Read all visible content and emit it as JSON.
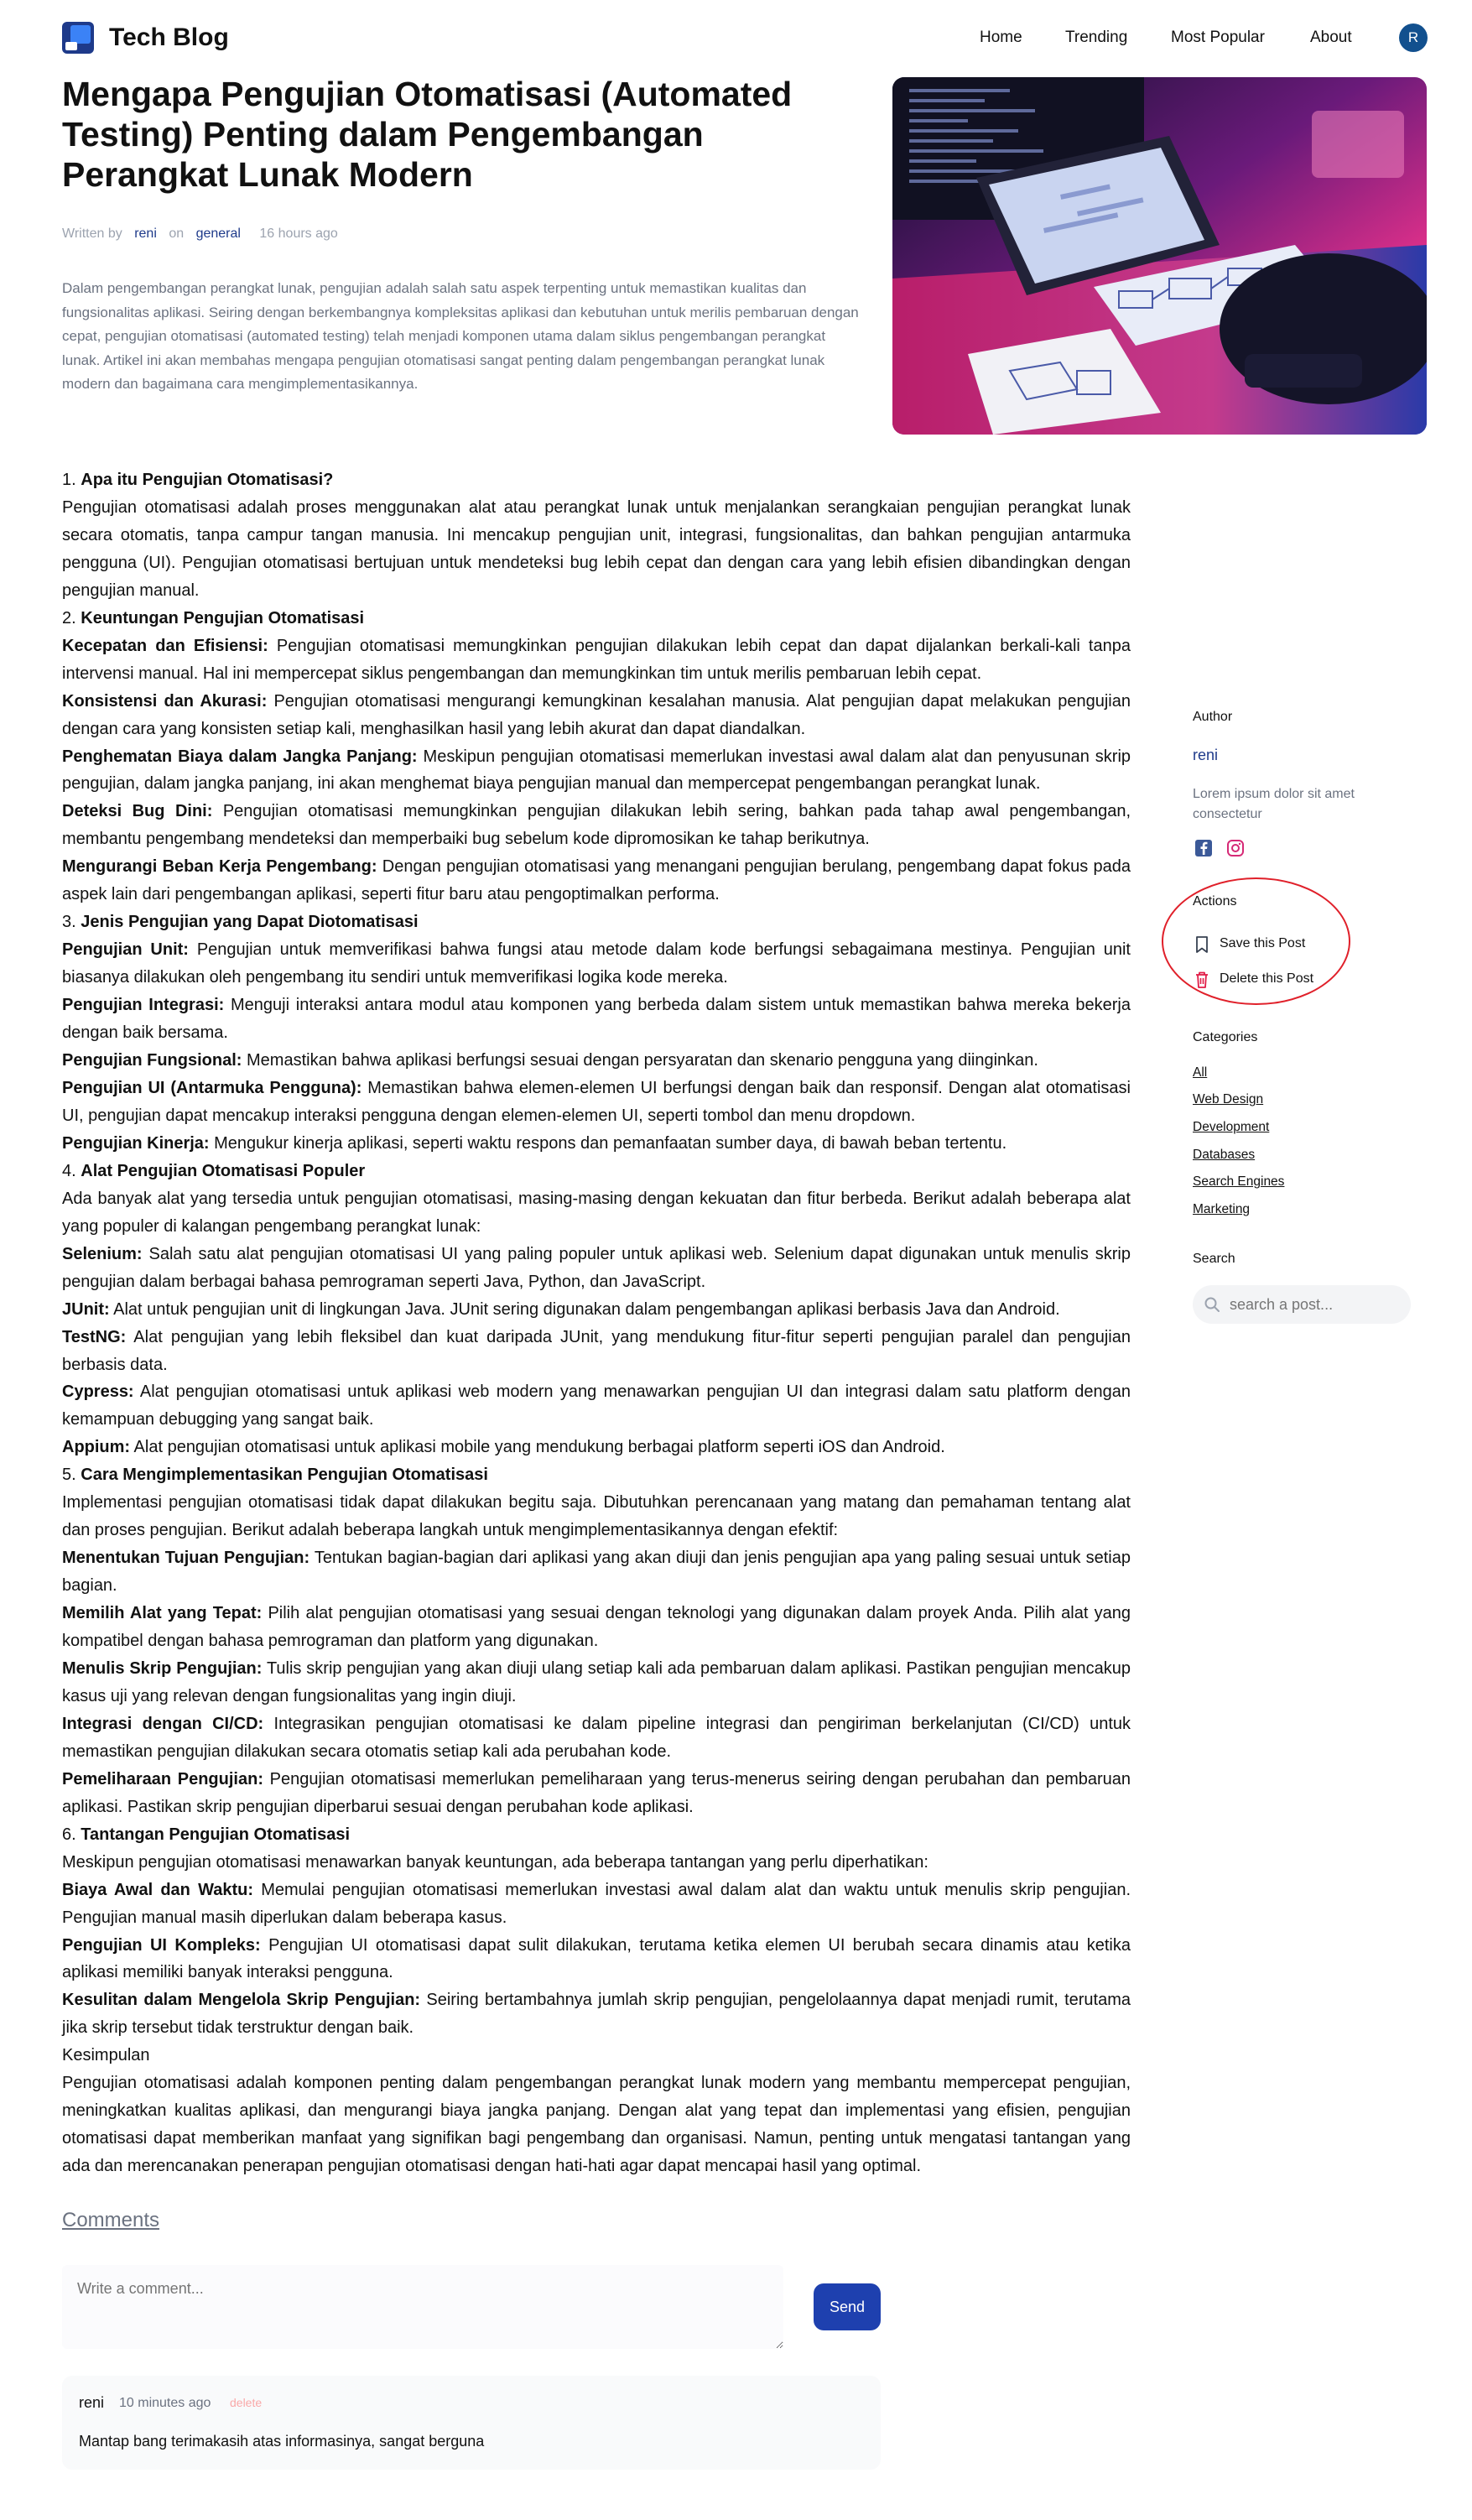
{
  "header": {
    "brand": "Tech Blog",
    "nav": [
      "Home",
      "Trending",
      "Most Popular",
      "About"
    ],
    "avatar_initial": "R"
  },
  "post": {
    "title": "Mengapa Pengujian Otomatisasi (Automated Testing) Penting dalam Pengembangan Perangkat Lunak Modern",
    "meta": {
      "written_by_label": "Written by",
      "author": "reni",
      "on_label": "on",
      "category": "general",
      "time": "16 hours ago"
    },
    "excerpt": "Dalam pengembangan perangkat lunak, pengujian adalah salah satu aspek terpenting untuk memastikan kualitas dan fungsionalitas aplikasi. Seiring dengan berkembangnya kompleksitas aplikasi dan kebutuhan untuk merilis pembaruan dengan cepat, pengujian otomatisasi (automated testing) telah menjadi komponen utama dalam siklus pengembangan perangkat lunak. Artikel ini akan membahas mengapa pengujian otomatisasi sangat penting dalam pengembangan perangkat lunak modern dan bagaimana cara mengimplementasikannya.",
    "hero_image": "laptop-coding-illustration"
  },
  "article": [
    {
      "type": "heading",
      "num": "1. ",
      "text": "Apa itu Pengujian Otomatisasi?"
    },
    {
      "type": "para",
      "text": "Pengujian otomatisasi adalah proses menggunakan alat atau perangkat lunak untuk menjalankan serangkaian pengujian perangkat lunak secara otomatis, tanpa campur tangan manusia. Ini mencakup pengujian unit, integrasi, fungsionalitas, dan bahkan pengujian antarmuka pengguna (UI). Pengujian otomatisasi bertujuan untuk mendeteksi bug lebih cepat dan dengan cara yang lebih efisien dibandingkan dengan pengujian manual."
    },
    {
      "type": "heading",
      "num": "2. ",
      "text": "Keuntungan Pengujian Otomatisasi"
    },
    {
      "type": "term",
      "term": "Kecepatan dan Efisiensi:",
      "text": " Pengujian otomatisasi memungkinkan pengujian dilakukan lebih cepat dan dapat dijalankan berkali-kali tanpa intervensi manual. Hal ini mempercepat siklus pengembangan dan memungkinkan tim untuk merilis pembaruan lebih cepat."
    },
    {
      "type": "term",
      "term": "Konsistensi dan Akurasi:",
      "text": " Pengujian otomatisasi mengurangi kemungkinan kesalahan manusia. Alat pengujian dapat melakukan pengujian dengan cara yang konsisten setiap kali, menghasilkan hasil yang lebih akurat dan dapat diandalkan."
    },
    {
      "type": "term",
      "term": "Penghematan Biaya dalam Jangka Panjang:",
      "text": " Meskipun pengujian otomatisasi memerlukan investasi awal dalam alat dan penyusunan skrip pengujian, dalam jangka panjang, ini akan menghemat biaya pengujian manual dan mempercepat pengembangan perangkat lunak."
    },
    {
      "type": "term",
      "term": "Deteksi Bug Dini:",
      "text": " Pengujian otomatisasi memungkinkan pengujian dilakukan lebih sering, bahkan pada tahap awal pengembangan, membantu pengembang mendeteksi dan memperbaiki bug sebelum kode dipromosikan ke tahap berikutnya."
    },
    {
      "type": "term",
      "term": "Mengurangi Beban Kerja Pengembang:",
      "text": " Dengan pengujian otomatisasi yang menangani pengujian berulang, pengembang dapat fokus pada aspek lain dari pengembangan aplikasi, seperti fitur baru atau pengoptimalkan performa."
    },
    {
      "type": "heading",
      "num": "3. ",
      "text": "Jenis Pengujian yang Dapat Diotomatisasi"
    },
    {
      "type": "term",
      "term": "Pengujian Unit:",
      "text": " Pengujian untuk memverifikasi bahwa fungsi atau metode dalam kode berfungsi sebagaimana mestinya. Pengujian unit biasanya dilakukan oleh pengembang itu sendiri untuk memverifikasi logika kode mereka."
    },
    {
      "type": "term",
      "term": "Pengujian Integrasi:",
      "text": " Menguji interaksi antara modul atau komponen yang berbeda dalam sistem untuk memastikan bahwa mereka bekerja dengan baik bersama."
    },
    {
      "type": "term",
      "term": "Pengujian Fungsional:",
      "text": " Memastikan bahwa aplikasi berfungsi sesuai dengan persyaratan dan skenario pengguna yang diinginkan."
    },
    {
      "type": "term",
      "term": "Pengujian UI (Antarmuka Pengguna):",
      "text": " Memastikan bahwa elemen-elemen UI berfungsi dengan baik dan responsif. Dengan alat otomatisasi UI, pengujian dapat mencakup interaksi pengguna dengan elemen-elemen UI, seperti tombol dan menu dropdown."
    },
    {
      "type": "term",
      "term": "Pengujian Kinerja:",
      "text": " Mengukur kinerja aplikasi, seperti waktu respons dan pemanfaatan sumber daya, di bawah beban tertentu."
    },
    {
      "type": "heading",
      "num": "4. ",
      "text": "Alat Pengujian Otomatisasi Populer"
    },
    {
      "type": "para",
      "text": "Ada banyak alat yang tersedia untuk pengujian otomatisasi, masing-masing dengan kekuatan dan fitur berbeda. Berikut adalah beberapa alat yang populer di kalangan pengembang perangkat lunak:"
    },
    {
      "type": "term",
      "term": "Selenium:",
      "text": " Salah satu alat pengujian otomatisasi UI yang paling populer untuk aplikasi web. Selenium dapat digunakan untuk menulis skrip pengujian dalam berbagai bahasa pemrograman seperti Java, Python, dan JavaScript."
    },
    {
      "type": "term",
      "term": "JUnit:",
      "text": " Alat untuk pengujian unit di lingkungan Java. JUnit sering digunakan dalam pengembangan aplikasi berbasis Java dan Android."
    },
    {
      "type": "term",
      "term": "TestNG:",
      "text": " Alat pengujian yang lebih fleksibel dan kuat daripada JUnit, yang mendukung fitur-fitur seperti pengujian paralel dan pengujian berbasis data."
    },
    {
      "type": "term",
      "term": "Cypress:",
      "text": " Alat pengujian otomatisasi untuk aplikasi web modern yang menawarkan pengujian UI dan integrasi dalam satu platform dengan kemampuan debugging yang sangat baik."
    },
    {
      "type": "term",
      "term": "Appium:",
      "text": " Alat pengujian otomatisasi untuk aplikasi mobile yang mendukung berbagai platform seperti iOS dan Android."
    },
    {
      "type": "heading",
      "num": "5. ",
      "text": "Cara Mengimplementasikan Pengujian Otomatisasi"
    },
    {
      "type": "para",
      "text": "Implementasi pengujian otomatisasi tidak dapat dilakukan begitu saja. Dibutuhkan perencanaan yang matang dan pemahaman tentang alat dan proses pengujian. Berikut adalah beberapa langkah untuk mengimplementasikannya dengan efektif:"
    },
    {
      "type": "term",
      "term": "Menentukan Tujuan Pengujian:",
      "text": " Tentukan bagian-bagian dari aplikasi yang akan diuji dan jenis pengujian apa yang paling sesuai untuk setiap bagian."
    },
    {
      "type": "term",
      "term": "Memilih Alat yang Tepat:",
      "text": " Pilih alat pengujian otomatisasi yang sesuai dengan teknologi yang digunakan dalam proyek Anda. Pilih alat yang kompatibel dengan bahasa pemrograman dan platform yang digunakan."
    },
    {
      "type": "term",
      "term": "Menulis Skrip Pengujian:",
      "text": " Tulis skrip pengujian yang akan diuji ulang setiap kali ada pembaruan dalam aplikasi. Pastikan pengujian mencakup kasus uji yang relevan dengan fungsionalitas yang ingin diuji."
    },
    {
      "type": "term",
      "term": "Integrasi dengan CI/CD:",
      "text": " Integrasikan pengujian otomatisasi ke dalam pipeline integrasi dan pengiriman berkelanjutan (CI/CD) untuk memastikan pengujian dilakukan secara otomatis setiap kali ada perubahan kode."
    },
    {
      "type": "term",
      "term": "Pemeliharaan Pengujian:",
      "text": " Pengujian otomatisasi memerlukan pemeliharaan yang terus-menerus seiring dengan perubahan dan pembaruan aplikasi. Pastikan skrip pengujian diperbarui sesuai dengan perubahan kode aplikasi."
    },
    {
      "type": "heading",
      "num": "6. ",
      "text": "Tantangan Pengujian Otomatisasi"
    },
    {
      "type": "para",
      "text": "Meskipun pengujian otomatisasi menawarkan banyak keuntungan, ada beberapa tantangan yang perlu diperhatikan:"
    },
    {
      "type": "term",
      "term": "Biaya Awal dan Waktu:",
      "text": " Memulai pengujian otomatisasi memerlukan investasi awal dalam alat dan waktu untuk menulis skrip pengujian. Pengujian manual masih diperlukan dalam beberapa kasus."
    },
    {
      "type": "term",
      "term": "Pengujian UI Kompleks:",
      "text": " Pengujian UI otomatisasi dapat sulit dilakukan, terutama ketika elemen UI berubah secara dinamis atau ketika aplikasi memiliki banyak interaksi pengguna."
    },
    {
      "type": "term",
      "term": "Kesulitan dalam Mengelola Skrip Pengujian:",
      "text": " Seiring bertambahnya jumlah skrip pengujian, pengelolaannya dapat menjadi rumit, terutama jika skrip tersebut tidak terstruktur dengan baik."
    },
    {
      "type": "para",
      "text": "Kesimpulan"
    },
    {
      "type": "para",
      "text": "Pengujian otomatisasi adalah komponen penting dalam pengembangan perangkat lunak modern yang membantu mempercepat pengujian, meningkatkan kualitas aplikasi, dan mengurangi biaya jangka panjang. Dengan alat yang tepat dan implementasi yang efisien, pengujian otomatisasi dapat memberikan manfaat yang signifikan bagi pengembang dan organisasi. Namun, penting untuk mengatasi tantangan yang ada dan merencanakan penerapan pengujian otomatisasi dengan hati-hati agar dapat mencapai hasil yang optimal."
    }
  ],
  "comments": {
    "title": "Comments",
    "placeholder": "Write a comment...",
    "send_label": "Send",
    "items": [
      {
        "user": "reni",
        "time": "10 minutes ago",
        "delete_label": "delete",
        "text": "Mantap bang terimakasih atas informasinya, sangat berguna"
      }
    ]
  },
  "sidebar": {
    "author_heading": "Author",
    "author_name": "reni",
    "author_bio": "Lorem ipsum dolor sit amet consectetur",
    "social_icons": [
      "facebook-icon",
      "instagram-icon"
    ],
    "actions_heading": "Actions",
    "save_label": "Save this Post",
    "delete_label": "Delete this Post",
    "categories_heading": "Categories",
    "categories": [
      "All",
      "Web Design",
      "Development",
      "Databases",
      "Search Engines",
      "Marketing"
    ],
    "search_heading": "Search",
    "search_placeholder": "search a post..."
  },
  "colors": {
    "accent": "#1e3a8a",
    "button": "#1e40af",
    "annotation": "#e0202a",
    "instagram": "#d62976",
    "facebook": "#3b5998",
    "delete_icon": "#e11d48"
  }
}
